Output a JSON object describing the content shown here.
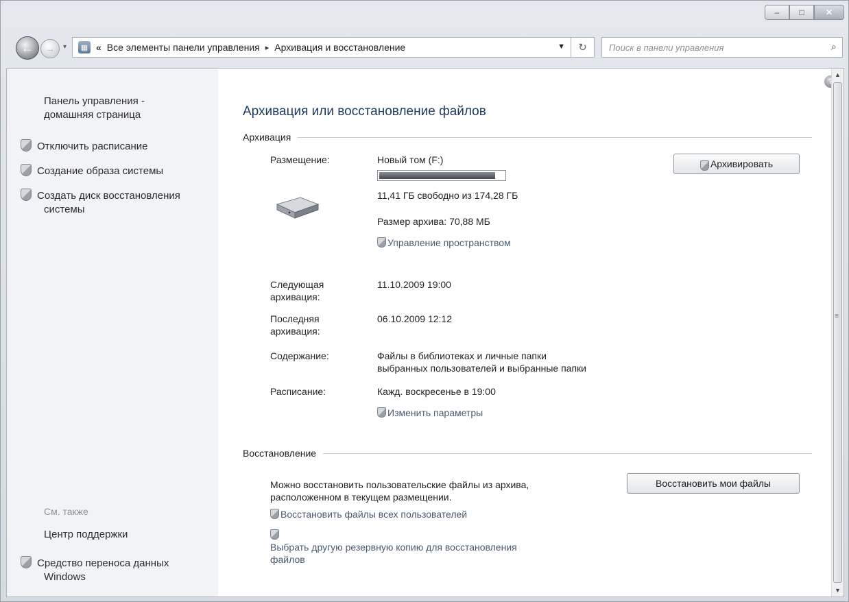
{
  "window": {
    "caption_minimize": "–",
    "caption_maximize": "□",
    "caption_close": "✕"
  },
  "nav": {
    "chevrons": "«",
    "breadcrumb_1": "Все элементы панели управления",
    "breadcrumb_sep": "▸",
    "breadcrumb_2": "Архивация и восстановление",
    "search_placeholder": "Поиск в панели управления"
  },
  "sidebar": {
    "home_line1": "Панель управления -",
    "home_line2": "домашняя страница",
    "items": [
      {
        "label": "Отключить расписание"
      },
      {
        "label": "Создание образа системы"
      },
      {
        "label_line1": "Создать диск восстановления",
        "label_line2": "системы"
      }
    ],
    "see_also": "См. также",
    "support_center": "Центр поддержки",
    "transfer_line1": "Средство переноса данных",
    "transfer_line2": "Windows"
  },
  "main": {
    "title": "Архивация или восстановление файлов",
    "backup_group": "Архивация",
    "location_label": "Размещение:",
    "location_value": "Новый том (F:)",
    "disk_usage_fraction": 0.93,
    "free_space": "11,41 ГБ свободно из 174,28 ГБ",
    "archive_size": "Размер архива: 70,88 МБ",
    "manage_space": "Управление пространством",
    "backup_button": "Архивировать",
    "next_label_line1": "Следующая",
    "next_label_line2": "архивация:",
    "next_value": "11.10.2009 19:00",
    "last_label_line1": "Последняя",
    "last_label_line2": "архивация:",
    "last_value": "06.10.2009 12:12",
    "contents_label": "Содержание:",
    "contents_line1": "Файлы в библиотеках и личные папки",
    "contents_line2": "выбранных пользователей и выбранные папки",
    "schedule_label": "Расписание:",
    "schedule_value": "Кажд. воскресенье в 19:00",
    "change_settings": "Изменить параметры",
    "restore_group": "Восстановление",
    "restore_text_line1": "Можно восстановить пользовательские файлы из архива,",
    "restore_text_line2": "расположенном в текущем размещении.",
    "restore_button": "Восстановить мои файлы",
    "restore_all_users": "Восстановить файлы всех пользователей",
    "choose_other_line1": "Выбрать другую резервную копию для восстановления",
    "choose_other_line2": "файлов"
  },
  "icons": {
    "back": "back-arrow-icon",
    "forward": "forward-arrow-icon",
    "refresh": "refresh-icon",
    "search": "search-icon",
    "help": "help-icon",
    "shield": "uac-shield-icon",
    "drive": "hard-drive-icon"
  }
}
